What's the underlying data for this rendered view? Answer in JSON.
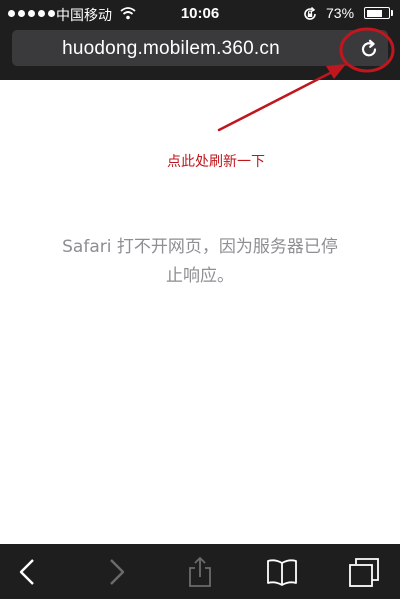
{
  "status_bar": {
    "carrier": "中国移动",
    "time": "10:06",
    "battery_percent": "73%",
    "battery_level": 0.73,
    "signal_bars": 5,
    "icons": [
      "signal-dots-icon",
      "wifi-icon",
      "rotation-lock-icon",
      "battery-icon"
    ]
  },
  "address_bar": {
    "url": "huodong.mobilem.360.cn",
    "reload_icon": "reload-icon"
  },
  "annotation": {
    "text": "点此处刷新一下",
    "color": "#c0161e"
  },
  "page": {
    "error_message": "Safari 打不开网页，因为服务器已停止响应。"
  },
  "toolbar": {
    "items": [
      {
        "icon": "back-icon",
        "enabled": true
      },
      {
        "icon": "forward-icon",
        "enabled": false
      },
      {
        "icon": "share-icon",
        "enabled": false
      },
      {
        "icon": "bookmarks-icon",
        "enabled": true
      },
      {
        "icon": "tabs-icon",
        "enabled": true
      }
    ]
  },
  "colors": {
    "bar_background": "#1e1e1e",
    "address_field": "#3a3a3c",
    "error_text": "#8e8e93",
    "disabled_icon": "#6b6b6b"
  }
}
